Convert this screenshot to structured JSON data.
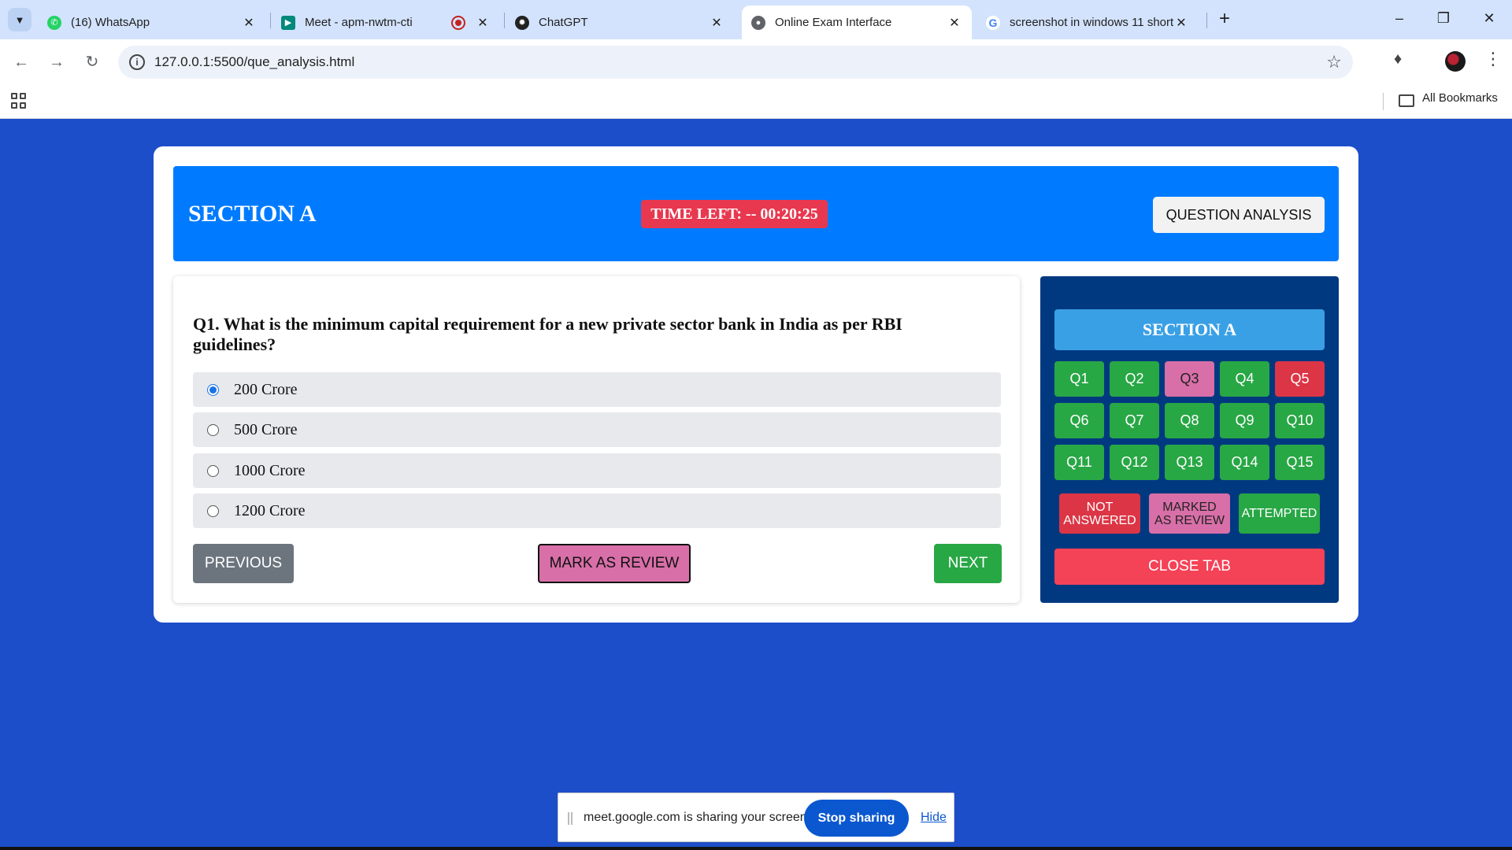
{
  "browser": {
    "tabs": [
      {
        "title": "(16) WhatsApp",
        "icon": "whatsapp-icon",
        "color": "#25d366"
      },
      {
        "title": "Meet - apm-nwtm-cti",
        "icon": "google-meet-icon",
        "color": "#00897b"
      },
      {
        "title": "ChatGPT",
        "icon": "chatgpt-icon",
        "color": "#222222"
      },
      {
        "title": "Online Exam Interface",
        "icon": "globe-icon",
        "color": "#5f6368"
      },
      {
        "title": "screenshot in windows 11 short",
        "icon": "google-icon",
        "color": "#4285f4"
      }
    ],
    "url": "127.0.0.1:5500/que_analysis.html",
    "bookmarks_label": "All Bookmarks"
  },
  "exam": {
    "section_title": "SECTION A",
    "timer_text": "TIME LEFT: -- 00:20:25",
    "question_analysis_label": "QUESTION ANALYSIS",
    "question": "Q1. What is the minimum capital requirement for a new private sector bank in India as per RBI guidelines?",
    "options": [
      {
        "label": "200 Crore",
        "selected": true
      },
      {
        "label": "500 Crore",
        "selected": false
      },
      {
        "label": "1000 Crore",
        "selected": false
      },
      {
        "label": "1200 Crore",
        "selected": false
      }
    ],
    "prev_label": "PREVIOUS",
    "mark_label": "MARK AS REVIEW",
    "next_label": "NEXT"
  },
  "sidebar": {
    "title": "SECTION A",
    "questions": [
      {
        "label": "Q1",
        "status": "attempted"
      },
      {
        "label": "Q2",
        "status": "attempted"
      },
      {
        "label": "Q3",
        "status": "review"
      },
      {
        "label": "Q4",
        "status": "attempted"
      },
      {
        "label": "Q5",
        "status": "unanswered"
      },
      {
        "label": "Q6",
        "status": "attempted"
      },
      {
        "label": "Q7",
        "status": "attempted"
      },
      {
        "label": "Q8",
        "status": "attempted"
      },
      {
        "label": "Q9",
        "status": "attempted"
      },
      {
        "label": "Q10",
        "status": "attempted"
      },
      {
        "label": "Q11",
        "status": "attempted"
      },
      {
        "label": "Q12",
        "status": "attempted"
      },
      {
        "label": "Q13",
        "status": "attempted"
      },
      {
        "label": "Q14",
        "status": "attempted"
      },
      {
        "label": "Q15",
        "status": "attempted"
      }
    ],
    "legend": {
      "not_answered_1": "NOT",
      "not_answered_2": "ANSWERED",
      "marked_1": "MARKED",
      "marked_2": "AS REVIEW",
      "attempted": "ATTEMPTED"
    },
    "close_label": "CLOSE TAB"
  },
  "share_bar": {
    "message": "meet.google.com is sharing your screen.",
    "stop_label": "Stop sharing",
    "hide_label": "Hide"
  },
  "colors": {
    "page_bg": "#1d4ec9",
    "header_blue": "#007bff",
    "attempted": "#28a745",
    "review": "#d86fa8",
    "unanswered": "#dc3545",
    "timer_bg": "#e8384f",
    "sidebar_bg": "#003980"
  }
}
